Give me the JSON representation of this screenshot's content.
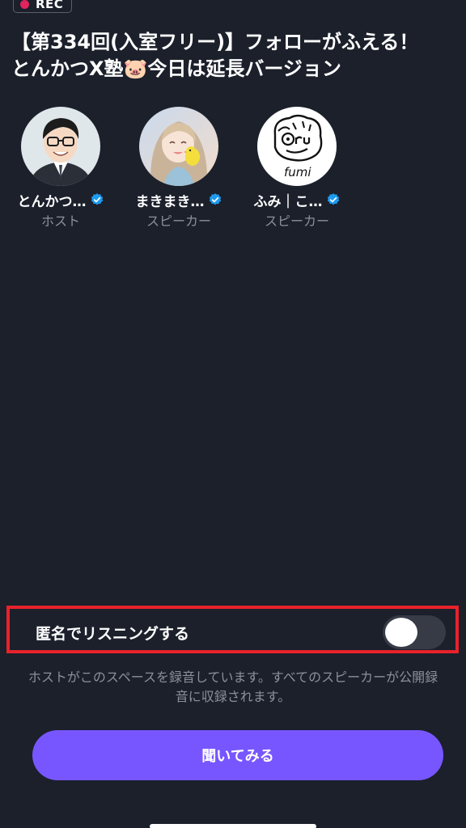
{
  "recording": {
    "label": "REC",
    "dot_color": "#e0245e"
  },
  "space": {
    "title_line1": "【第334回(入室フリー)】フォローがふえる！",
    "title_line2": "とんかつX塾🐷今日は延長バージョン"
  },
  "participants": [
    {
      "name": "とんかつ…",
      "role": "ホスト",
      "verified": true,
      "avatar": "man-with-glasses-avatar"
    },
    {
      "name": "まきまき…",
      "role": "スピーカー",
      "verified": true,
      "avatar": "girl-with-bird-avatar"
    },
    {
      "name": "ふみ｜こ…",
      "role": "スピーカー",
      "verified": true,
      "avatar": "fumi-drawing-avatar"
    }
  ],
  "anonymous": {
    "label": "匿名でリスニングする",
    "enabled": false
  },
  "notice": "ホストがこのスペースを録音しています。すべてのスピーカーが公開録音に収録されます。",
  "primary_button": {
    "label": "聞いてみる",
    "color": "#7856ff"
  },
  "colors": {
    "background": "#1b202b",
    "verified": "#1d9bf0",
    "highlight_border": "#e8222b"
  }
}
